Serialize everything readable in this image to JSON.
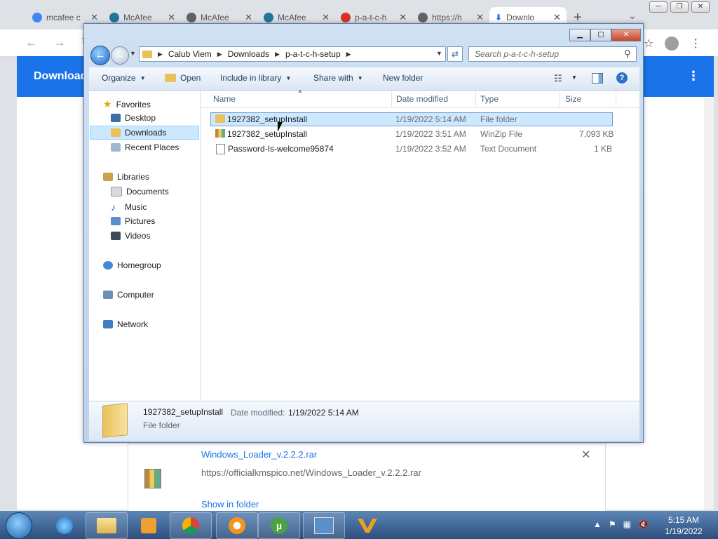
{
  "browser": {
    "tabs": [
      {
        "label": "mcafee c",
        "icon": "google-icon",
        "color": "#4285f4"
      },
      {
        "label": "McAfee",
        "icon": "wordpress-icon",
        "color": "#21759b"
      },
      {
        "label": "McAfee",
        "icon": "globe-icon",
        "color": "#5f6368"
      },
      {
        "label": "McAfee",
        "icon": "wordpress-icon",
        "color": "#21759b"
      },
      {
        "label": "p-a-t-c-h",
        "icon": "red-site-icon",
        "color": "#d93025"
      },
      {
        "label": "https://h",
        "icon": "globe-icon",
        "color": "#5f6368"
      },
      {
        "label": "Downlo",
        "icon": "download-icon",
        "color": "#1a73e8"
      }
    ],
    "new_tab": "+",
    "page_title": "Download",
    "download_item": {
      "filename": "Windows_Loader_v.2.2.2.rar",
      "url": "https://officialkmspico.net/Windows_Loader_v.2.2.2.rar",
      "show_in_folder": "Show in folder",
      "close": "✕"
    }
  },
  "explorer": {
    "breadcrumbs": [
      "Calub Viem",
      "Downloads",
      "p-a-t-c-h-setup"
    ],
    "search_placeholder": "Search p-a-t-c-h-setup",
    "commands": {
      "organize": "Organize",
      "open": "Open",
      "include": "Include in library",
      "share": "Share with",
      "new_folder": "New folder"
    },
    "nav": {
      "favorites": "Favorites",
      "desktop": "Desktop",
      "downloads": "Downloads",
      "recent": "Recent Places",
      "libraries": "Libraries",
      "documents": "Documents",
      "music": "Music",
      "pictures": "Pictures",
      "videos": "Videos",
      "homegroup": "Homegroup",
      "computer": "Computer",
      "network": "Network"
    },
    "columns": {
      "name": "Name",
      "date": "Date modified",
      "type": "Type",
      "size": "Size"
    },
    "files": [
      {
        "name": "1927382_setupInstall",
        "date": "1/19/2022 5:14 AM",
        "type": "File folder",
        "size": ""
      },
      {
        "name": "1927382_setupInstall",
        "date": "1/19/2022 3:51 AM",
        "type": "WinZip File",
        "size": "7,093 KB"
      },
      {
        "name": "Password-Is-welcome95874",
        "date": "1/19/2022 3:52 AM",
        "type": "Text Document",
        "size": "1 KB"
      }
    ],
    "details": {
      "name": "1927382_setupInstall",
      "modified_label": "Date modified:",
      "modified": "1/19/2022 5:14 AM",
      "type": "File folder"
    }
  },
  "taskbar": {
    "time": "5:15 AM",
    "date": "1/19/2022"
  }
}
